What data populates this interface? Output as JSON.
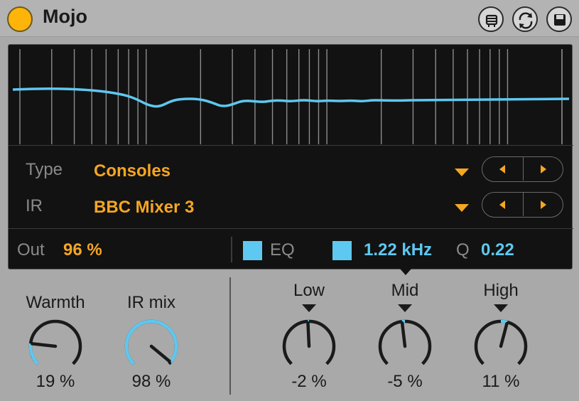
{
  "device": {
    "title": "Mojo",
    "accent_color": "#ffb40a",
    "title_buttons": [
      {
        "icon": "hot-swap-icon"
      },
      {
        "icon": "preset-swap-icon"
      },
      {
        "icon": "save-icon"
      }
    ]
  },
  "params": {
    "type_label": "Type",
    "type_value": "Consoles",
    "ir_label": "IR",
    "ir_value": "BBC Mixer 3",
    "out_label": "Out",
    "out_value": "96 %",
    "eq_label": "EQ",
    "eq_enabled": true,
    "freq_enabled": true,
    "freq_value": "1.22 kHz",
    "q_label": "Q",
    "q_value": "0.22"
  },
  "knobs": [
    {
      "id": "warmth",
      "label": "Warmth",
      "value": "19 %",
      "fraction": 0.19
    },
    {
      "id": "ir-mix",
      "label": "IR mix",
      "value": "98 %",
      "fraction": 0.98
    },
    {
      "id": "low",
      "label": "Low",
      "value": "-2 %",
      "fraction": 0.49,
      "bipolar": true
    },
    {
      "id": "mid",
      "label": "Mid",
      "value": "-5 %",
      "fraction": 0.475,
      "bipolar": true
    },
    {
      "id": "high",
      "label": "High",
      "value": "11 %",
      "fraction": 0.555,
      "bipolar": true
    }
  ],
  "colors": {
    "value_orange": "#f5a623",
    "eq_blue": "#5ec8f0"
  }
}
